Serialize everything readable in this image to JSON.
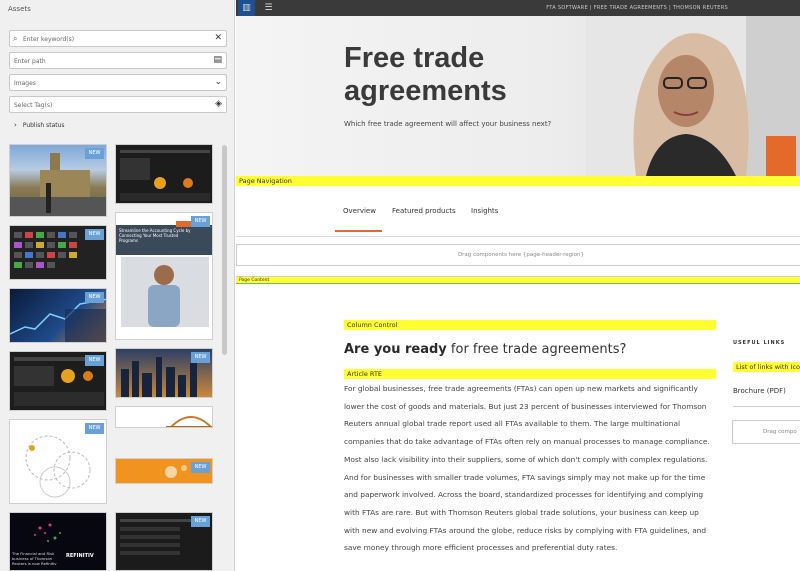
{
  "assets_panel": {
    "title": "Assets",
    "keyword_placeholder": "Enter keyword(s)",
    "path_placeholder": "Enter path",
    "type_value": "Images",
    "tags_placeholder": "Select Tag(s)",
    "publish_status": "Publish status",
    "new_badge": "NEW",
    "thumbs": [
      {
        "name": "thumb-parliament",
        "new": true
      },
      {
        "name": "thumb-dashboard-1",
        "new": false
      },
      {
        "name": "thumb-keyboard",
        "new": true
      },
      {
        "name": "thumb-accounting-cycle",
        "new": true,
        "caption": "Streamline the Accounting Cycle by Connecting Your Most Trusted Programs"
      },
      {
        "name": "thumb-tablet",
        "new": true
      },
      {
        "name": "thumb-dashboard-2",
        "new": true
      },
      {
        "name": "thumb-city",
        "new": true
      },
      {
        "name": "thumb-gears",
        "new": true
      },
      {
        "name": "thumb-bridge",
        "new": false
      },
      {
        "name": "thumb-orange",
        "new": true
      },
      {
        "name": "thumb-refinitiv",
        "new": false,
        "caption": "The Financial and Risk business of Thomson Reuters is now Refinitiv",
        "logo": "REFINITIV"
      },
      {
        "name": "thumb-dashboard-3",
        "new": true
      }
    ]
  },
  "toolbar": {
    "site_title": "FTA SOFTWARE | FREE TRADE AGREEMENTS | THOMSON REUTERS"
  },
  "hero": {
    "title": "Free trade agreements",
    "subtitle": "Which free trade agreement will affect your business next?"
  },
  "labels": {
    "page_navigation": "Page Navigation",
    "page_content": "Page Content",
    "column_control": "Column Control",
    "article_rte": "Article RTE",
    "list_links": "List of links with Icon"
  },
  "nav": {
    "items": [
      "Overview",
      "Featured products",
      "Insights"
    ],
    "active": "Overview"
  },
  "drag_zone": "Drag components here {page-header-region}",
  "article": {
    "heading_bold": "Are you ready",
    "heading_rest": " for free trade agreements?",
    "body": "For global businesses, free trade agreements (FTAs) can open up new markets and significantly lower the cost of goods and materials. But just 23 percent of businesses interviewed for Thomson Reuters annual global trade report used all FTAs available to them. The large multinational companies that do take advantage of FTAs often rely on manual processes to manage compliance. Most also lack visibility into their suppliers, some of which don't comply with complex regulations. And for businesses with smaller trade volumes, FTA savings simply may not make up for the time and paperwork involved. Across the board, standardized processes for identifying and complying with FTAs are rare. But with Thomson Reuters global trade solutions, your business can keep up with new and evolving FTAs around the globe, reduce risks by complying with FTA guidelines, and save money through more efficient processes and preferential duty rates."
  },
  "sidebar": {
    "heading": "USEFUL LINKS",
    "link": "Brochure (PDF)",
    "drag": "Drag compo"
  },
  "colors": {
    "accent": "#e46a2b",
    "highlight": "#ffff33",
    "badge": "#6aa0d8"
  }
}
